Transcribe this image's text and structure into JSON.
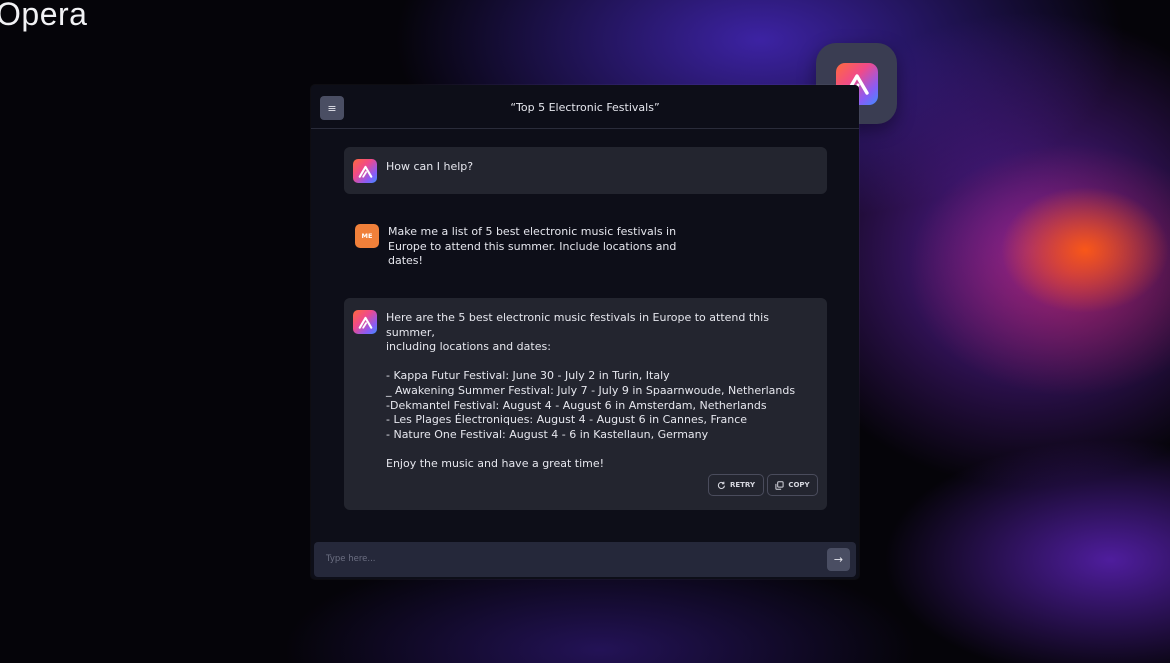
{
  "brand": {
    "name": "Opera"
  },
  "chat": {
    "title": "“Top 5 Electronic Festivals”",
    "greeting": "How can I help?",
    "user_avatar_label": "ME",
    "user_message": [
      "Make me a list of 5 best electronic music festivals in",
      "Europe to attend this summer. Include locations and",
      "dates!"
    ],
    "assistant_reply": {
      "intro": [
        "Here are the 5 best electronic music festivals in Europe to attend this summer,",
        "including locations and dates:"
      ],
      "list": [
        "- Kappa Futur Festival: June 30 - July 2 in Turin, Italy",
        "_ Awakening Summer Festival: July 7 - July 9 in Spaarnwoude, Netherlands",
        "-Dekmantel Festival: August 4 - August 6 in Amsterdam, Netherlands",
        "- Les Plages Électroniques: August 4 - August 6 in Cannes, France",
        "- Nature One Festival: August 4 - 6 in Kastellaun, Germany"
      ],
      "outro": "Enjoy the music and have a great time!"
    },
    "actions": {
      "retry": "RETRY",
      "copy": "COPY"
    },
    "input": {
      "placeholder": "Type  here..."
    }
  },
  "icons": {
    "menu": "menu-icon",
    "aria": "aria-logo-icon",
    "retry": "refresh-icon",
    "copy": "copy-icon",
    "send": "arrow-right-icon"
  },
  "colors": {
    "window_bg": "#0d0e18",
    "bubble_bg": "#23252f",
    "me_avatar": "#f0803a",
    "accent_orange": "#ff5a14",
    "accent_purple": "#7828d2"
  }
}
